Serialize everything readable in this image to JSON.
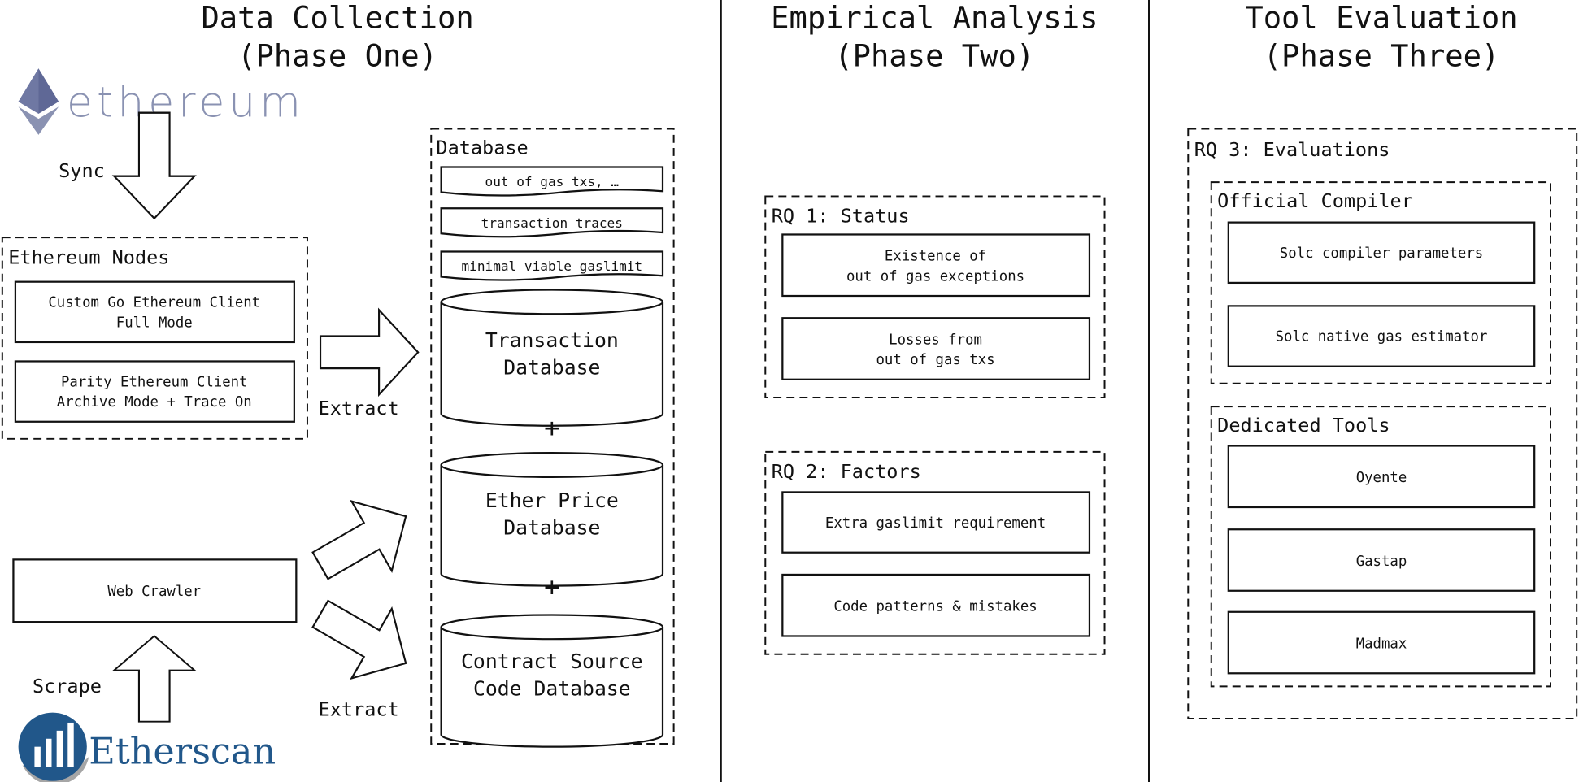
{
  "phases": [
    {
      "title": "Data Collection",
      "subtitle": "(Phase One)"
    },
    {
      "title": "Empirical Analysis",
      "subtitle": "(Phase Two)"
    },
    {
      "title": "Tool Evaluation",
      "subtitle": "(Phase Three)"
    }
  ],
  "logos": {
    "ethereum": {
      "text": "ethereum",
      "color": "#8a92b2"
    },
    "etherscan": {
      "text": "Etherscan",
      "color": "#21578a",
      "accent": "#a6a6a6"
    }
  },
  "arrows": {
    "sync": "Sync",
    "extract_top": "Extract",
    "extract_bottom": "Extract",
    "scrape": "Scrape"
  },
  "nodes": {
    "label": "Ethereum Nodes",
    "items": [
      {
        "line1": "Custom Go Ethereum Client",
        "line2": "Full Mode"
      },
      {
        "line1": "Parity Ethereum Client",
        "line2": "Archive Mode + Trace On"
      }
    ]
  },
  "crawler": {
    "label": "Web Crawler"
  },
  "database": {
    "label": "Database",
    "slips": [
      "out of gas txs, …",
      "transaction traces",
      "minimal viable gaslimit"
    ],
    "cylinders": [
      {
        "line1": "Transaction",
        "line2": "Database"
      },
      {
        "line1": "Ether Price",
        "line2": "Database"
      },
      {
        "line1": "Contract Source",
        "line2": "Code Database"
      }
    ],
    "plus": "+"
  },
  "rq1": {
    "label": "RQ 1: Status",
    "items": [
      {
        "line1": "Existence of",
        "line2": "out of gas exceptions"
      },
      {
        "line1": "Losses from",
        "line2": "out of gas txs"
      }
    ]
  },
  "rq2": {
    "label": "RQ 2: Factors",
    "items": [
      "Extra gaslimit requirement",
      "Code patterns & mistakes"
    ]
  },
  "rq3": {
    "label": "RQ 3: Evaluations",
    "compiler": {
      "label": "Official Compiler",
      "items": [
        "Solc compiler parameters",
        "Solc native gas estimator"
      ]
    },
    "tools": {
      "label": "Dedicated Tools",
      "items": [
        "Oyente",
        "Gastap",
        "Madmax"
      ]
    }
  }
}
